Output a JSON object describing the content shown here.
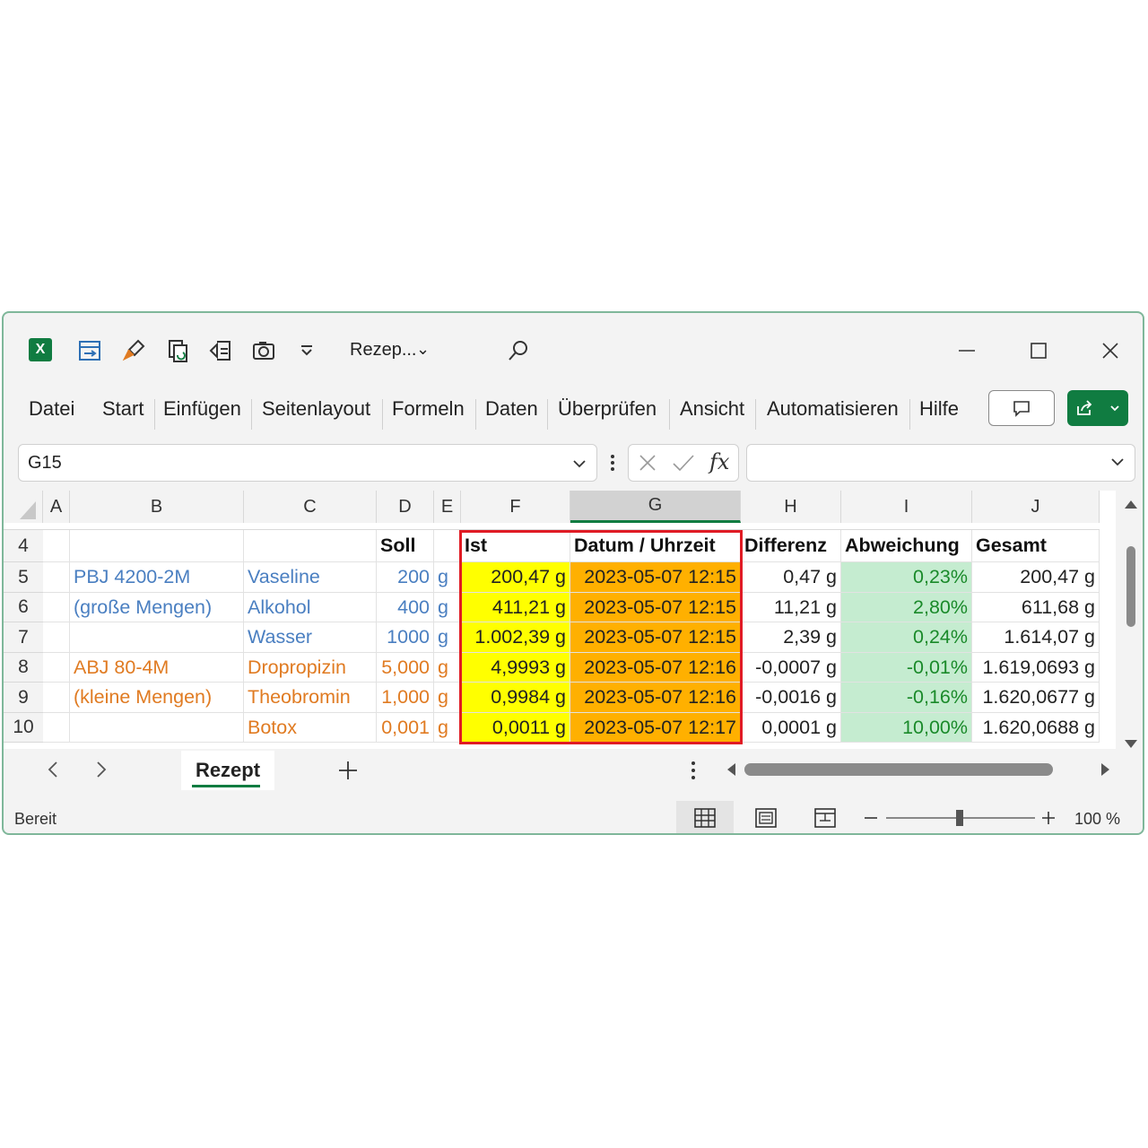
{
  "titlebar": {
    "doc_title": "Rezep...",
    "quick_access_icons": [
      "autosave-icon",
      "format-painter-icon",
      "copy-icon",
      "import-icon",
      "camera-icon",
      "customize-icon"
    ],
    "minimize": "—",
    "maximize": "☐",
    "close": "✕"
  },
  "ribbon": {
    "tabs": [
      "Datei",
      "Start",
      "Einfügen",
      "Seitenlayout",
      "Formeln",
      "Daten",
      "Überprüfen",
      "Ansicht",
      "Automatisieren",
      "Hilfe"
    ]
  },
  "formula_bar": {
    "name_box": "G15",
    "formula": ""
  },
  "columns": [
    "A",
    "B",
    "C",
    "D",
    "E",
    "F",
    "G",
    "H",
    "I",
    "J"
  ],
  "selected_column": "G",
  "rows": [
    {
      "num": "4",
      "B": "",
      "C": "",
      "D": "Soll",
      "E": "",
      "F": "Ist",
      "G": "Datum / Uhrzeit",
      "H": "Differenz",
      "I": "Abweichung",
      "J": "Gesamt"
    },
    {
      "num": "5",
      "B": "PBJ 4200-2M",
      "C": "Vaseline",
      "D": "200",
      "E": "g",
      "F": "200,47 g",
      "G": "2023-05-07 12:15",
      "H": "0,47 g",
      "I": "0,23%",
      "J": "200,47 g"
    },
    {
      "num": "6",
      "B": "(große Mengen)",
      "C": "Alkohol",
      "D": "400",
      "E": "g",
      "F": "411,21 g",
      "G": "2023-05-07 12:15",
      "H": "11,21 g",
      "I": "2,80%",
      "J": "611,68 g"
    },
    {
      "num": "7",
      "B": "",
      "C": "Wasser",
      "D": "1000",
      "E": "g",
      "F": "1.002,39 g",
      "G": "2023-05-07 12:15",
      "H": "2,39 g",
      "I": "0,24%",
      "J": "1.614,07 g"
    },
    {
      "num": "8",
      "B": "ABJ 80-4M",
      "C": "Dropropizin",
      "D": "5,000",
      "E": "g",
      "F": "4,9993 g",
      "G": "2023-05-07 12:16",
      "H": "-0,0007 g",
      "I": "-0,01%",
      "J": "1.619,0693 g"
    },
    {
      "num": "9",
      "B": "(kleine Mengen)",
      "C": "Theobromin",
      "D": "1,000",
      "E": "g",
      "F": "0,9984 g",
      "G": "2023-05-07 12:16",
      "H": "-0,0016 g",
      "I": "-0,16%",
      "J": "1.620,0677 g"
    },
    {
      "num": "10",
      "B": "",
      "C": "Botox",
      "D": "0,001",
      "E": "g",
      "F": "0,0011 g",
      "G": "2023-05-07 12:17",
      "H": "0,0001 g",
      "I": "10,00%",
      "J": "1.620,0688 g"
    }
  ],
  "sheet_tabs": [
    "Rezept"
  ],
  "status": {
    "ready": "Bereit",
    "zoom": "100 %"
  },
  "colors": {
    "accent": "#107c41",
    "yellow_fill": "#ffff00",
    "orange_fill": "#ffb000",
    "green_fill": "#c5ecd0",
    "highlight_border": "#e01b24",
    "blue_text": "#4a7fc1",
    "orange_text": "#e07b22"
  }
}
